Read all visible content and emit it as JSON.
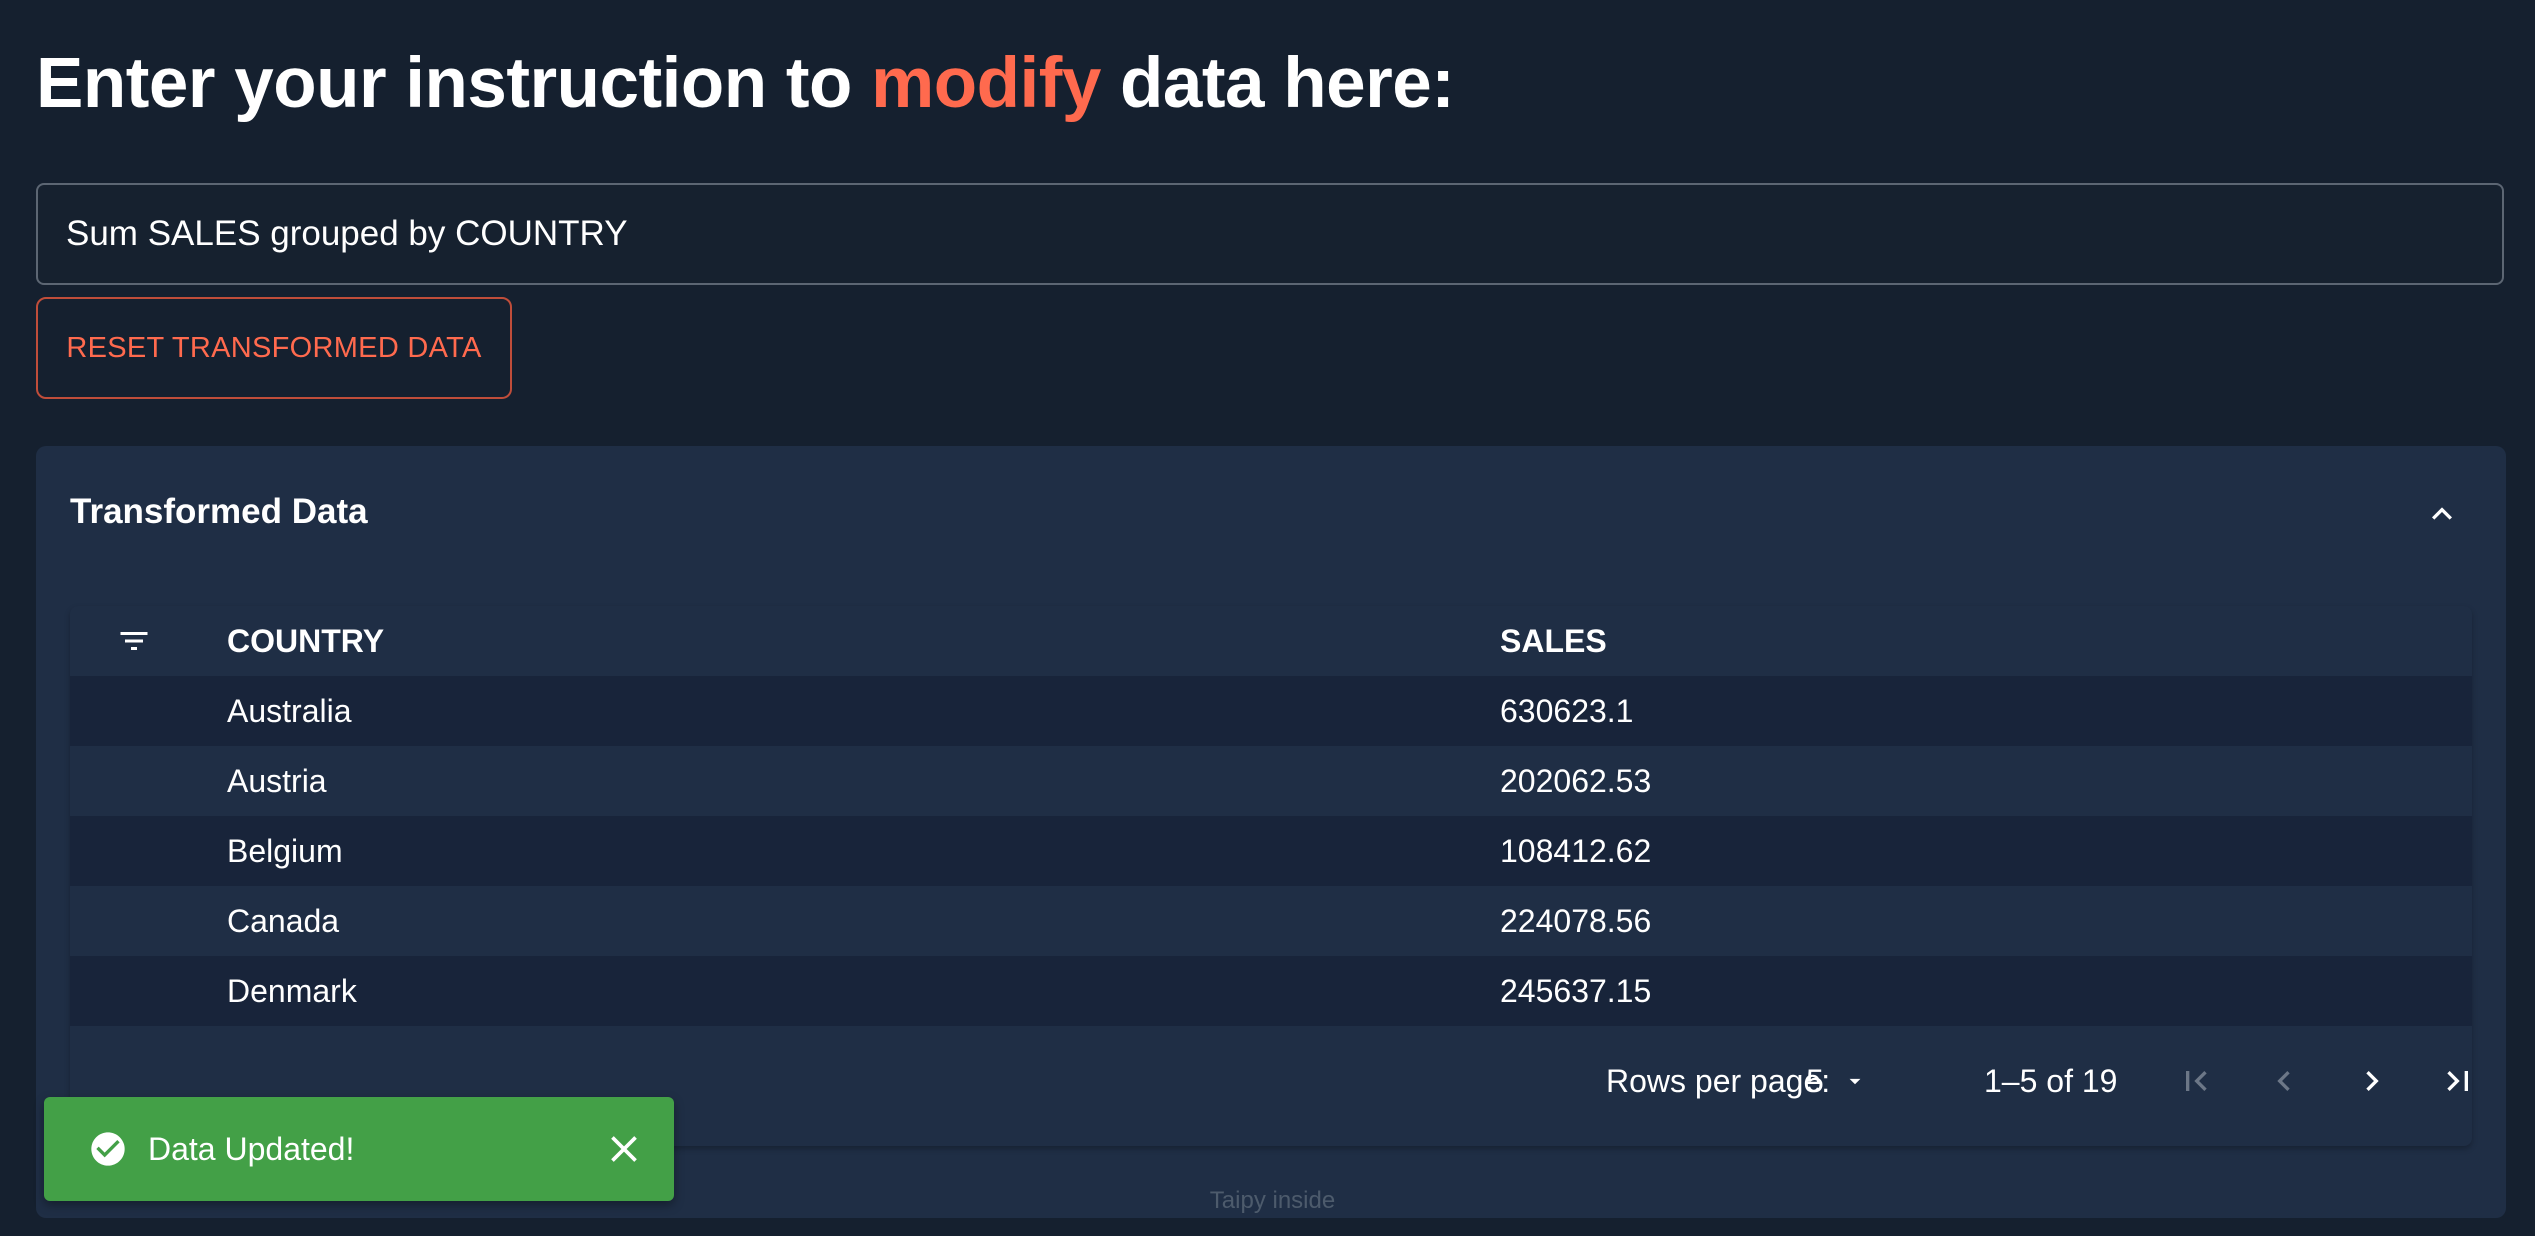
{
  "header": {
    "title_prefix": "Enter your instruction to ",
    "title_accent": "modify",
    "title_suffix": " data here:"
  },
  "instruction_input": {
    "value": "Sum SALES grouped by COUNTRY"
  },
  "reset_button": {
    "label": "RESET TRANSFORMED DATA"
  },
  "panel": {
    "title": "Transformed Data",
    "collapse_icon": "chevron-up-icon"
  },
  "table": {
    "filter_icon": "filter-icon",
    "columns": [
      "COUNTRY",
      "SALES"
    ],
    "rows": [
      [
        "Australia",
        "630623.1"
      ],
      [
        "Austria",
        "202062.53"
      ],
      [
        "Belgium",
        "108412.62"
      ],
      [
        "Canada",
        "224078.56"
      ],
      [
        "Denmark",
        "245637.15"
      ]
    ]
  },
  "pagination": {
    "rows_per_page_label": "Rows per page:",
    "rows_per_page_value": "5",
    "range_text": "1–5 of 19",
    "icons": [
      "first-page-icon",
      "previous-page-icon",
      "next-page-icon",
      "last-page-icon"
    ]
  },
  "footer": {
    "text": "Taipy inside"
  },
  "toast": {
    "message": "Data Updated!",
    "icon": "check-circle-icon",
    "close_icon": "close-icon"
  },
  "colors": {
    "background": "#15202f",
    "accent": "#ff6a4e",
    "panel": "#1f2e45",
    "success": "#43a047"
  }
}
